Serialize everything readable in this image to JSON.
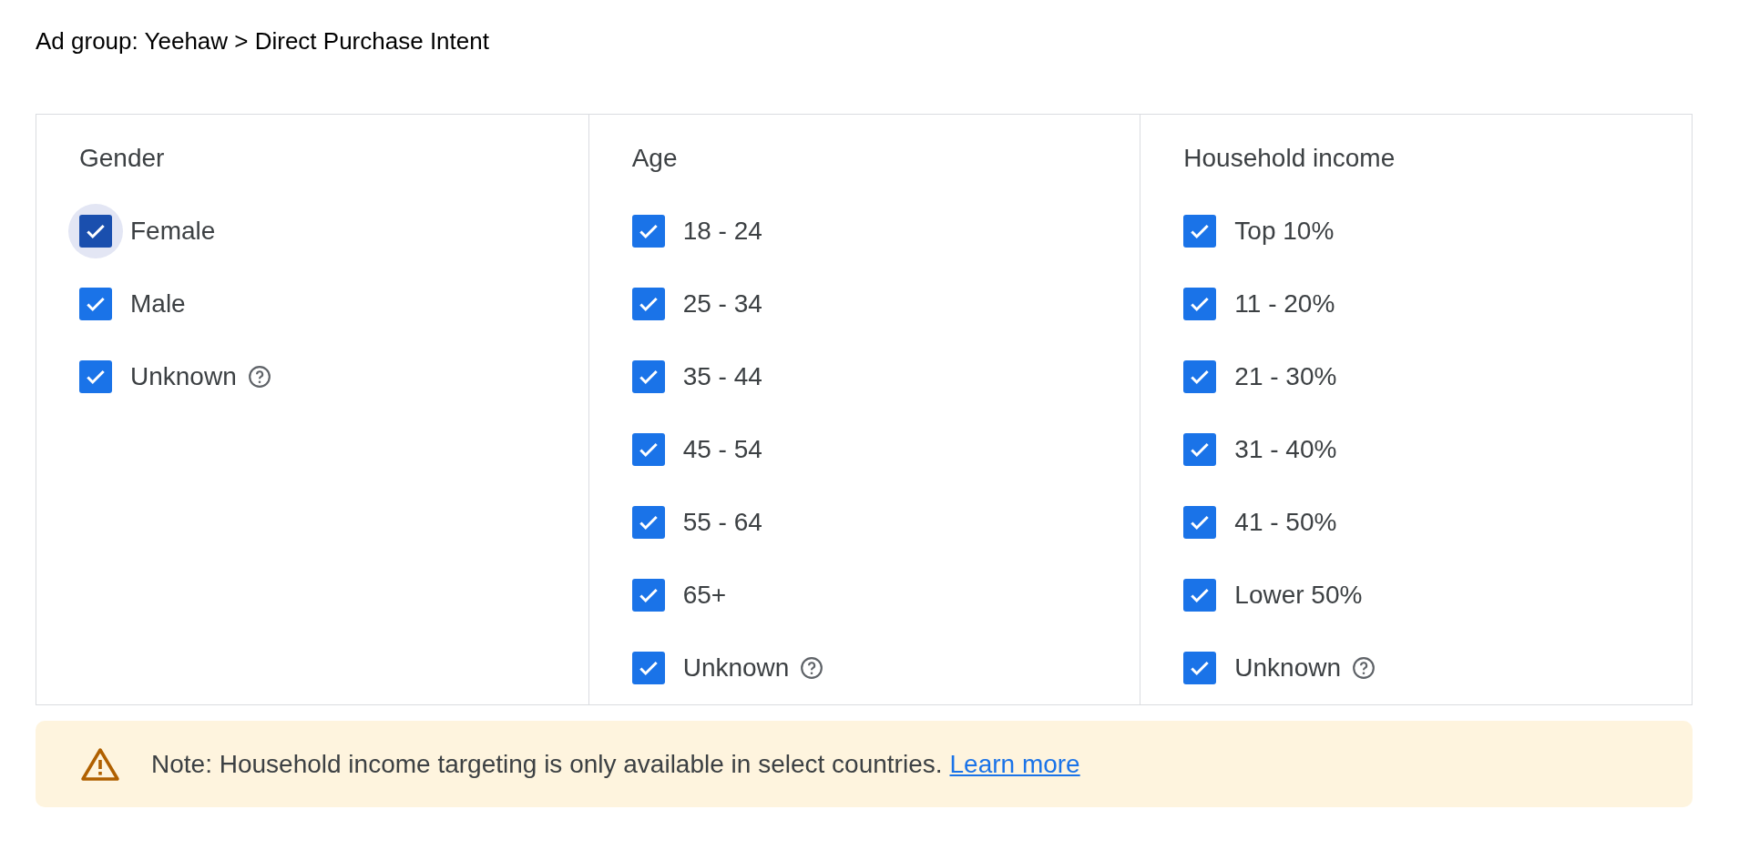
{
  "breadcrumb": "Ad group: Yeehaw > Direct Purchase Intent",
  "columns": [
    {
      "title": "Gender",
      "options": [
        {
          "label": "Female",
          "checked": true,
          "focused": true,
          "help": false
        },
        {
          "label": "Male",
          "checked": true,
          "focused": false,
          "help": false
        },
        {
          "label": "Unknown",
          "checked": true,
          "focused": false,
          "help": true
        }
      ]
    },
    {
      "title": "Age",
      "options": [
        {
          "label": "18 - 24",
          "checked": true,
          "focused": false,
          "help": false
        },
        {
          "label": "25 - 34",
          "checked": true,
          "focused": false,
          "help": false
        },
        {
          "label": "35 - 44",
          "checked": true,
          "focused": false,
          "help": false
        },
        {
          "label": "45 - 54",
          "checked": true,
          "focused": false,
          "help": false
        },
        {
          "label": "55 - 64",
          "checked": true,
          "focused": false,
          "help": false
        },
        {
          "label": "65+",
          "checked": true,
          "focused": false,
          "help": false
        },
        {
          "label": "Unknown",
          "checked": true,
          "focused": false,
          "help": true
        }
      ]
    },
    {
      "title": "Household income",
      "options": [
        {
          "label": "Top 10%",
          "checked": true,
          "focused": false,
          "help": false
        },
        {
          "label": "11 - 20%",
          "checked": true,
          "focused": false,
          "help": false
        },
        {
          "label": "21 - 30%",
          "checked": true,
          "focused": false,
          "help": false
        },
        {
          "label": "31 - 40%",
          "checked": true,
          "focused": false,
          "help": false
        },
        {
          "label": "41 - 50%",
          "checked": true,
          "focused": false,
          "help": false
        },
        {
          "label": "Lower 50%",
          "checked": true,
          "focused": false,
          "help": false
        },
        {
          "label": "Unknown",
          "checked": true,
          "focused": false,
          "help": true
        }
      ]
    }
  ],
  "note": {
    "text": "Note: Household income targeting is only available in select countries.",
    "link": "Learn more"
  }
}
